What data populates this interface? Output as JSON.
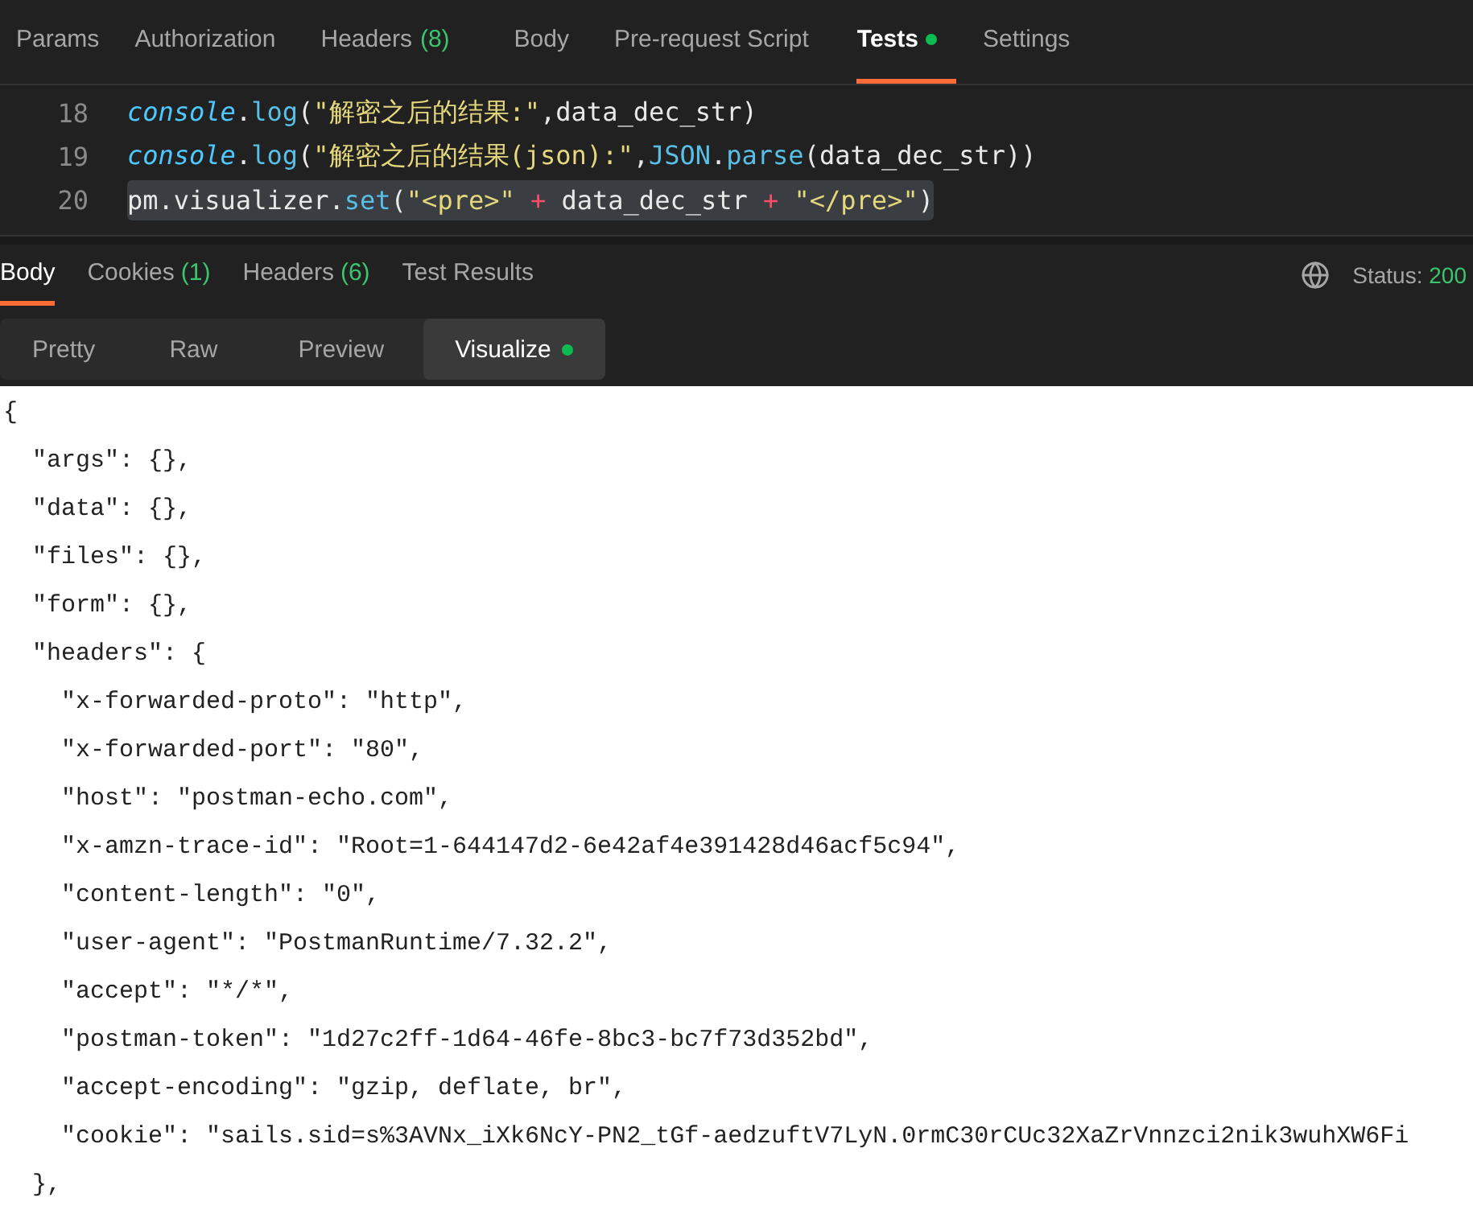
{
  "request_tabs": [
    {
      "label": "Params",
      "selected": false
    },
    {
      "label": "Authorization",
      "selected": false
    },
    {
      "label": "Headers",
      "count": "(8)",
      "selected": false
    },
    {
      "label": "Body",
      "selected": false
    },
    {
      "label": "Pre-request Script",
      "selected": false
    },
    {
      "label": "Tests",
      "dot": true,
      "selected": true
    },
    {
      "label": "Settings",
      "selected": false
    }
  ],
  "editor": {
    "lines": [
      {
        "number": "18",
        "highlighted": false,
        "tokens": [
          {
            "text": "console",
            "kind": "object"
          },
          {
            "text": ".",
            "kind": "punct"
          },
          {
            "text": "log",
            "kind": "method"
          },
          {
            "text": "(",
            "kind": "punct"
          },
          {
            "text": "\"解密之后的结果:\"",
            "kind": "string"
          },
          {
            "text": ",data_dec_str)",
            "kind": "punct"
          }
        ]
      },
      {
        "number": "19",
        "highlighted": false,
        "tokens": [
          {
            "text": "console",
            "kind": "object"
          },
          {
            "text": ".",
            "kind": "punct"
          },
          {
            "text": "log",
            "kind": "method"
          },
          {
            "text": "(",
            "kind": "punct"
          },
          {
            "text": "\"解密之后的结果(json):\"",
            "kind": "string"
          },
          {
            "text": ",",
            "kind": "punct"
          },
          {
            "text": "JSON",
            "kind": "method"
          },
          {
            "text": ".",
            "kind": "punct"
          },
          {
            "text": "parse",
            "kind": "method"
          },
          {
            "text": "(data_dec_str))",
            "kind": "punct"
          }
        ]
      },
      {
        "number": "20",
        "highlighted": true,
        "tokens": [
          {
            "text": "pm.visualizer",
            "kind": "punct"
          },
          {
            "text": ".",
            "kind": "punct"
          },
          {
            "text": "set",
            "kind": "method"
          },
          {
            "text": "(",
            "kind": "punct"
          },
          {
            "text": "\"<pre>\"",
            "kind": "string"
          },
          {
            "text": " + ",
            "kind": "operator"
          },
          {
            "text": "data_dec_str",
            "kind": "punct"
          },
          {
            "text": " + ",
            "kind": "operator"
          },
          {
            "text": "\"</pre>\"",
            "kind": "string"
          },
          {
            "text": ")",
            "kind": "punct"
          }
        ]
      }
    ]
  },
  "response_tabs": [
    {
      "label": "Body",
      "selected": true
    },
    {
      "label": "Cookies",
      "count": "(1)",
      "selected": false
    },
    {
      "label": "Headers",
      "count": "(6)",
      "selected": false
    },
    {
      "label": "Test Results",
      "selected": false
    }
  ],
  "status": {
    "label": "Status:",
    "value": "200"
  },
  "view_tabs": [
    {
      "label": "Pretty",
      "selected": false
    },
    {
      "label": "Raw",
      "selected": false
    },
    {
      "label": "Preview",
      "selected": false
    },
    {
      "label": "Visualize",
      "dot": true,
      "selected": true
    }
  ],
  "output_lines": [
    "{",
    "  \"args\": {},",
    "  \"data\": {},",
    "  \"files\": {},",
    "  \"form\": {},",
    "  \"headers\": {",
    "    \"x-forwarded-proto\": \"http\",",
    "    \"x-forwarded-port\": \"80\",",
    "    \"host\": \"postman-echo.com\",",
    "    \"x-amzn-trace-id\": \"Root=1-644147d2-6e42af4e391428d46acf5c94\",",
    "    \"content-length\": \"0\",",
    "    \"user-agent\": \"PostmanRuntime/7.32.2\",",
    "    \"accept\": \"*/*\",",
    "    \"postman-token\": \"1d27c2ff-1d64-46fe-8bc3-bc7f73d352bd\",",
    "    \"accept-encoding\": \"gzip, deflate, br\",",
    "    \"cookie\": \"sails.sid=s%3AVNx_iXk6NcY-PN2_tGf-aedzuftV7LyN.0rmC30rCUc32XaZrVnnzci2nik3wuhXW6Fi",
    "  },"
  ]
}
